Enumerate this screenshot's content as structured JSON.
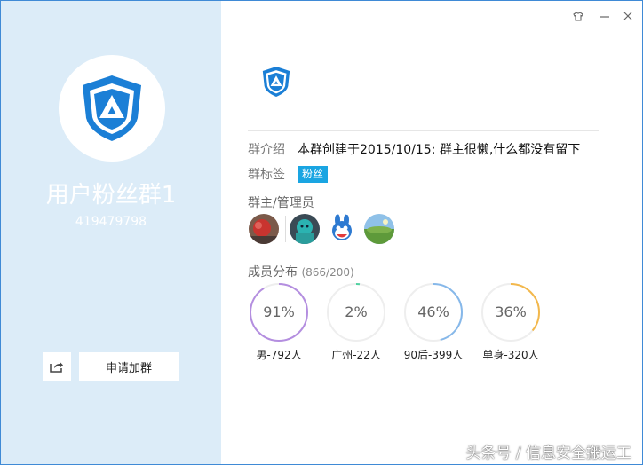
{
  "colors": {
    "left_panel": "#dcecf8",
    "brand_blue": "#1b7fd6",
    "tag_blue": "#1aa5e2",
    "ring_purple": "#b48ee0",
    "ring_green": "#4fd1a0",
    "ring_blue": "#86b8ea",
    "ring_orange": "#f3b84c",
    "ring_track": "#eeeeee"
  },
  "window": {
    "skin_icon": "skin-icon",
    "minimize_icon": "minimize-icon",
    "close_icon": "close-icon"
  },
  "profile": {
    "logo_icon": "shield-logo-icon",
    "name": "用户粉丝群1",
    "id": "419479798",
    "share_icon": "share-icon",
    "join_label": "申请加群"
  },
  "info": {
    "intro_label": "群介绍",
    "intro_text": "本群创建于2015/10/15:  群主很懒,什么都没有留下",
    "tags_label": "群标签",
    "tag": "粉丝",
    "admins_label": "群主/管理员",
    "admins": [
      "admin-1",
      "admin-2",
      "admin-3",
      "admin-4"
    ],
    "members_label": "成员分布",
    "members_count": "(866/200)"
  },
  "distribution": [
    {
      "percent": 91,
      "text": "91%",
      "caption": "男-792人",
      "color": "#b48ee0"
    },
    {
      "percent": 2,
      "text": "2%",
      "caption": "广州-22人",
      "color": "#4fd1a0"
    },
    {
      "percent": 46,
      "text": "46%",
      "caption": "90后-399人",
      "color": "#86b8ea"
    },
    {
      "percent": 36,
      "text": "36%",
      "caption": "单身-320人",
      "color": "#f3b84c"
    }
  ],
  "watermark": "头条号 / 信息安全搬运工"
}
